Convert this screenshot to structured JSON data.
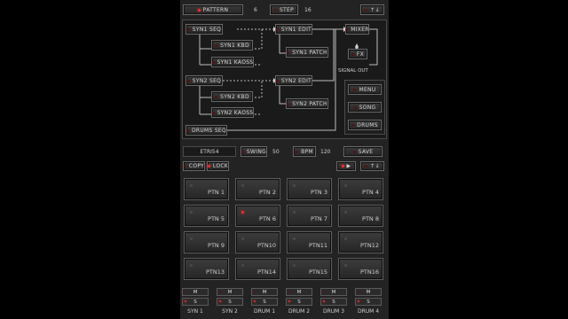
{
  "header": {
    "pattern_label": "PATTERN",
    "pattern_value": "6",
    "step_label": "STEP",
    "step_value": "16",
    "arrows": "↑↓"
  },
  "routing": {
    "synth1_seq": "SYN1 SEQ",
    "synth1_kbd": "SYN1 KBD",
    "synth1_kaoss": "SYN1 KAOSS",
    "synth1_edit": "SYN1 EDIT",
    "synth1_patch": "SYN1 PATCH",
    "synth2_seq": "SYN2 SEQ",
    "synth2_kbd": "SYN2 KBD",
    "synth2_kaoss": "SYN2 KAOSS",
    "synth2_edit": "SYN2 EDIT",
    "synth2_patch": "SYN2 PATCH",
    "drums_seq": "DRUMS SEQ",
    "mixer": "MIXER",
    "fx": "FX",
    "signal_out": "SIGNAL OUT",
    "menu": "MENU",
    "song": "SONG",
    "drums": "DRUMS"
  },
  "transport": {
    "song_name": "ETRI54",
    "swing_label": "SWING",
    "swing_value": "50",
    "bpm_label": "BPM",
    "bpm_value": "120",
    "save_label": "SAVE",
    "copy_label": "COPY",
    "lock_label": "LOCK",
    "play_symbol": "▶",
    "arrows": "↑↓"
  },
  "patterns": [
    {
      "label": "PTN 1",
      "active": false
    },
    {
      "label": "PTN 2",
      "active": false
    },
    {
      "label": "PTN 3",
      "active": false
    },
    {
      "label": "PTN 4",
      "active": false
    },
    {
      "label": "PTN 5",
      "active": false
    },
    {
      "label": "PTN 6",
      "active": true
    },
    {
      "label": "PTN 7",
      "active": false
    },
    {
      "label": "PTN 8",
      "active": false
    },
    {
      "label": "PTN 9",
      "active": false
    },
    {
      "label": "PTN10",
      "active": false
    },
    {
      "label": "PTN11",
      "active": false
    },
    {
      "label": "PTN12",
      "active": false
    },
    {
      "label": "PTN13",
      "active": false
    },
    {
      "label": "PTN14",
      "active": false
    },
    {
      "label": "PTN15",
      "active": false
    },
    {
      "label": "PTN16",
      "active": false
    }
  ],
  "tracks": [
    {
      "label": "SYN 1",
      "mute": "M",
      "solo": "S"
    },
    {
      "label": "SYN 2",
      "mute": "M",
      "solo": "S"
    },
    {
      "label": "DRUM 1",
      "mute": "M",
      "solo": "S"
    },
    {
      "label": "DRUM 2",
      "mute": "M",
      "solo": "S"
    },
    {
      "label": "DRUM 3",
      "mute": "M",
      "solo": "S"
    },
    {
      "label": "DRUM 4",
      "mute": "M",
      "solo": "S"
    }
  ],
  "colors": {
    "led_on": "#ff2a2a",
    "background": "#232323"
  }
}
